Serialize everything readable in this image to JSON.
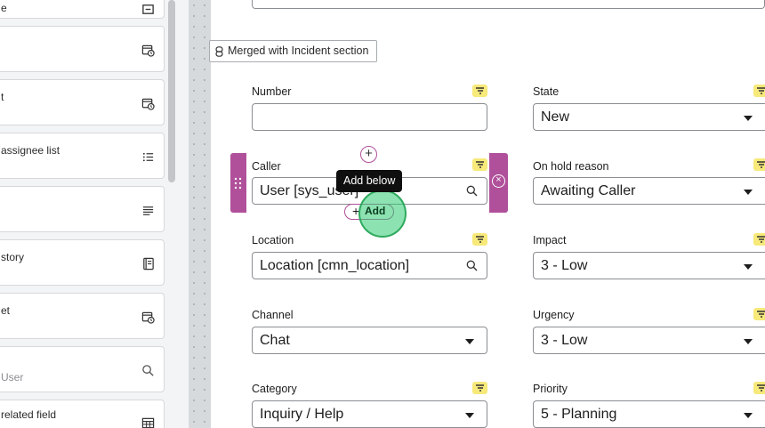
{
  "palette": {
    "items": [
      {
        "label": "e",
        "sub": "",
        "icon": "text-field-icon"
      },
      {
        "label": "",
        "sub": "",
        "icon": "date-time-icon"
      },
      {
        "label": "t",
        "sub": "",
        "icon": "date-time-icon"
      },
      {
        "label": "assignee list",
        "sub": "",
        "icon": "list-icon"
      },
      {
        "label": "",
        "sub": "",
        "icon": "text-lines-icon"
      },
      {
        "label": "story",
        "sub": "",
        "icon": "journal-icon"
      },
      {
        "label": "et",
        "sub": "",
        "icon": "date-time-icon"
      },
      {
        "label": "User",
        "sub": "",
        "icon": "search-icon"
      },
      {
        "label": "related field",
        "sub": "",
        "icon": "table-icon"
      }
    ]
  },
  "form": {
    "merged_badge": "Merged with Incident section",
    "tooltip": "Add below",
    "add_button": "Add",
    "fields": {
      "number": {
        "label": "Number",
        "value": ""
      },
      "state": {
        "label": "State",
        "value": "New"
      },
      "caller": {
        "label": "Caller",
        "value": "User [sys_user]"
      },
      "on_hold_reason": {
        "label": "On hold reason",
        "value": "Awaiting Caller"
      },
      "location": {
        "label": "Location",
        "value": "Location [cmn_location]"
      },
      "impact": {
        "label": "Impact",
        "value": "3 - Low"
      },
      "channel": {
        "label": "Channel",
        "value": "Chat"
      },
      "urgency": {
        "label": "Urgency",
        "value": "3 - Low"
      },
      "category": {
        "label": "Category",
        "value": "Inquiry / Help"
      },
      "priority": {
        "label": "Priority",
        "value": "5 - Planning"
      }
    }
  },
  "colors": {
    "selection": "#b0509a",
    "flag": "#f7e97a",
    "click_ring": "#2ecc71"
  }
}
